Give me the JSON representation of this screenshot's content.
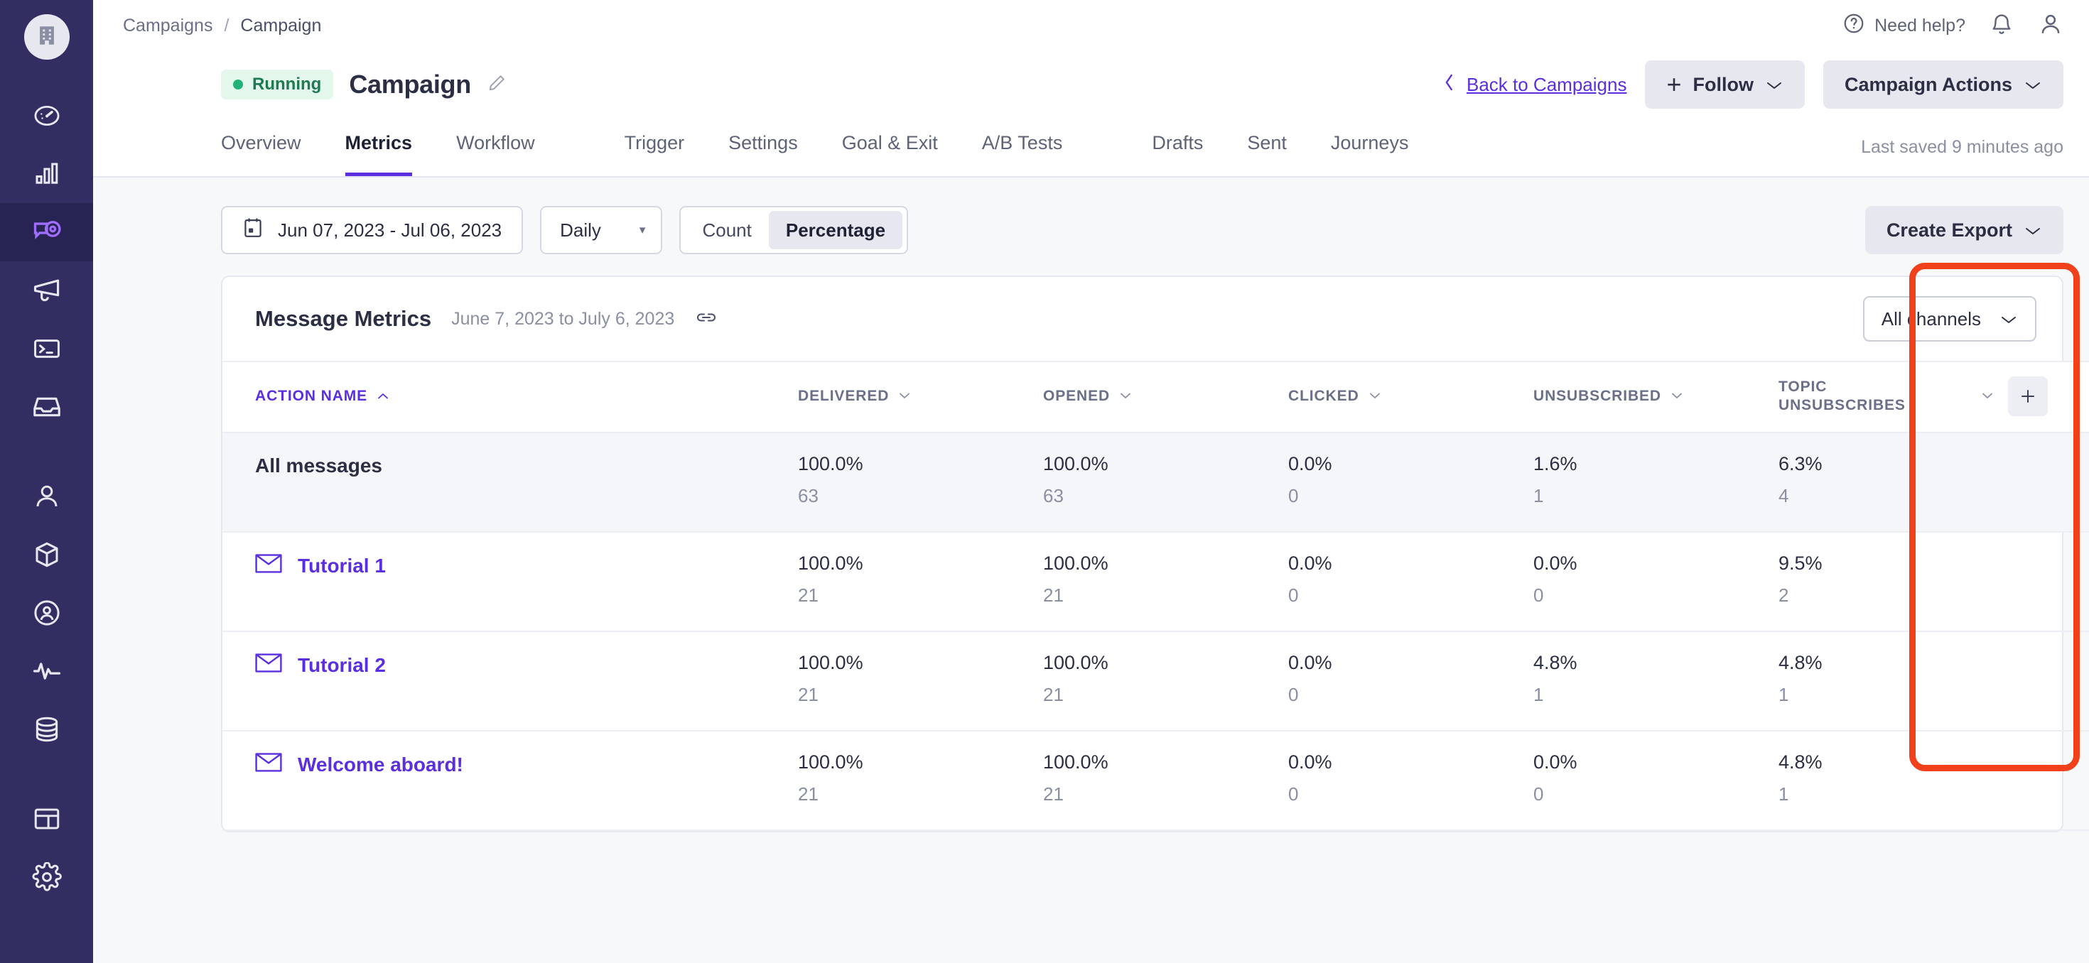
{
  "sidebar": {
    "logo_icon": "building-icon",
    "items": [
      {
        "icon": "speedometer-icon",
        "name": "dashboard",
        "active": false
      },
      {
        "icon": "bar-chart-icon",
        "name": "analytics",
        "active": false
      },
      {
        "icon": "message-target-icon",
        "name": "campaigns",
        "active": true
      },
      {
        "icon": "megaphone-icon",
        "name": "broadcasts",
        "active": false
      },
      {
        "icon": "terminal-icon",
        "name": "transactional",
        "active": false
      },
      {
        "icon": "inbox-icon",
        "name": "inbox",
        "active": false
      },
      {
        "icon": "person-icon",
        "name": "people",
        "active": false
      },
      {
        "icon": "cube-icon",
        "name": "objects",
        "active": false
      },
      {
        "icon": "person-circle-icon",
        "name": "segments",
        "active": false
      },
      {
        "icon": "activity-pulse-icon",
        "name": "activity",
        "active": false
      },
      {
        "icon": "database-icon",
        "name": "data",
        "active": false
      },
      {
        "icon": "layout-icon",
        "name": "content",
        "active": false
      },
      {
        "icon": "gear-icon",
        "name": "settings",
        "active": false
      }
    ]
  },
  "topbar": {
    "breadcrumb_root": "Campaigns",
    "breadcrumb_sep": "/",
    "breadcrumb_current": "Campaign",
    "need_help": "Need help?",
    "help_icon": "question-circle-icon",
    "bell_icon": "bell-icon",
    "account_icon": "user-avatar-icon"
  },
  "title": {
    "status": "Running",
    "name": "Campaign",
    "edit_icon": "pencil-icon",
    "back_label": "Back to Campaigns",
    "back_icon": "chevron-left-icon",
    "follow_label": "Follow",
    "follow_plus": "+",
    "follow_caret": "⌄",
    "actions_label": "Campaign Actions",
    "actions_caret": "⌄"
  },
  "tabs": {
    "group_one": [
      "Overview",
      "Metrics",
      "Workflow"
    ],
    "group_two": [
      "Trigger",
      "Settings",
      "Goal & Exit",
      "A/B Tests"
    ],
    "group_three": [
      "Drafts",
      "Sent",
      "Journeys"
    ],
    "active": "Metrics",
    "last_saved": "Last saved 9 minutes ago"
  },
  "filters": {
    "calendar_icon": "calendar-icon",
    "date_range": "Jun 07, 2023 - Jul 06, 2023",
    "granularity": "Daily",
    "granularity_caret": "▾",
    "mode_count": "Count",
    "mode_percentage": "Percentage",
    "mode_selected": "Percentage",
    "export_label": "Create Export",
    "export_caret": "⌄"
  },
  "card": {
    "title": "Message Metrics",
    "subtitle": "June 7, 2023 to July 6, 2023",
    "link_icon": "link-icon",
    "channel_label": "All channels",
    "channel_caret": "⌄"
  },
  "table": {
    "columns": [
      {
        "label": "ACTION NAME",
        "sort_icon": "caret-up-icon",
        "sorted": true
      },
      {
        "label": "DELIVERED",
        "sort_icon": "caret-down-icon",
        "sorted": false
      },
      {
        "label": "OPENED",
        "sort_icon": "caret-down-icon",
        "sorted": false
      },
      {
        "label": "CLICKED",
        "sort_icon": "caret-down-icon",
        "sorted": false
      },
      {
        "label": "UNSUBSCRIBED",
        "sort_icon": "caret-down-icon",
        "sorted": false
      },
      {
        "label": "TOPIC UNSUBSCRIBES",
        "sort_icon": "caret-down-icon",
        "sorted": false
      }
    ],
    "add_column_icon": "plus-icon",
    "rows": [
      {
        "name": "All messages",
        "icon": null,
        "is_link": false,
        "highlight_row": true,
        "delivered_pct": "100.0%",
        "delivered_cnt": "63",
        "opened_pct": "100.0%",
        "opened_cnt": "63",
        "clicked_pct": "0.0%",
        "clicked_cnt": "0",
        "unsub_pct": "1.6%",
        "unsub_cnt": "1",
        "topic_pct": "6.3%",
        "topic_cnt": "4"
      },
      {
        "name": "Tutorial 1",
        "icon": "envelope-icon",
        "is_link": true,
        "highlight_row": false,
        "delivered_pct": "100.0%",
        "delivered_cnt": "21",
        "opened_pct": "100.0%",
        "opened_cnt": "21",
        "clicked_pct": "0.0%",
        "clicked_cnt": "0",
        "unsub_pct": "0.0%",
        "unsub_cnt": "0",
        "topic_pct": "9.5%",
        "topic_cnt": "2"
      },
      {
        "name": "Tutorial 2",
        "icon": "envelope-icon",
        "is_link": true,
        "highlight_row": false,
        "delivered_pct": "100.0%",
        "delivered_cnt": "21",
        "opened_pct": "100.0%",
        "opened_cnt": "21",
        "clicked_pct": "0.0%",
        "clicked_cnt": "0",
        "unsub_pct": "4.8%",
        "unsub_cnt": "1",
        "topic_pct": "4.8%",
        "topic_cnt": "1"
      },
      {
        "name": "Welcome aboard!",
        "icon": "envelope-icon",
        "is_link": true,
        "highlight_row": false,
        "delivered_pct": "100.0%",
        "delivered_cnt": "21",
        "opened_pct": "100.0%",
        "opened_cnt": "21",
        "clicked_pct": "0.0%",
        "clicked_cnt": "0",
        "unsub_pct": "0.0%",
        "unsub_cnt": "0",
        "topic_pct": "4.8%",
        "topic_cnt": "1"
      }
    ]
  },
  "annotation": {
    "highlight_color": "#f0411b",
    "highlight_target": "TOPIC UNSUBSCRIBES"
  },
  "colors": {
    "sidebar_bg": "#322e62",
    "sidebar_active": "#272352",
    "accent_purple": "#5b2ee0",
    "status_green": "#21b277",
    "page_bg": "#f7f8fa"
  }
}
